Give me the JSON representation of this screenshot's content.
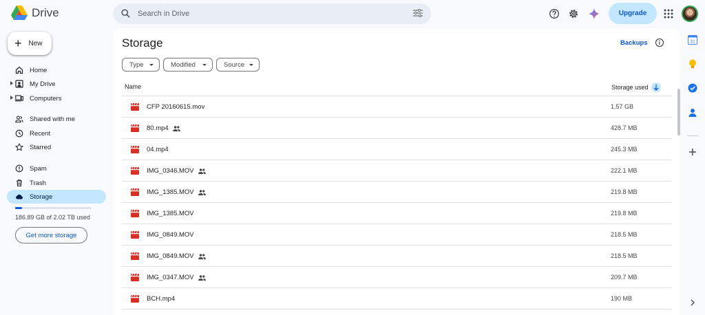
{
  "app": {
    "title": "Drive"
  },
  "search": {
    "placeholder": "Search in Drive"
  },
  "header": {
    "upgrade_label": "Upgrade"
  },
  "sidebar": {
    "new_label": "New",
    "items": [
      {
        "label": "Home",
        "icon": "home-icon"
      },
      {
        "label": "My Drive",
        "icon": "my-drive-icon"
      },
      {
        "label": "Computers",
        "icon": "computers-icon"
      },
      {
        "label": "Shared with me",
        "icon": "shared-with-me-icon"
      },
      {
        "label": "Recent",
        "icon": "clock-icon"
      },
      {
        "label": "Starred",
        "icon": "star-icon"
      },
      {
        "label": "Spam",
        "icon": "spam-icon"
      },
      {
        "label": "Trash",
        "icon": "trash-icon"
      },
      {
        "label": "Storage",
        "icon": "cloud-icon"
      }
    ],
    "storage_text": "186.89 GB of 2.02 TB used",
    "storage_fraction": 0.09,
    "get_more_label": "Get more storage"
  },
  "main": {
    "title": "Storage",
    "backups_label": "Backups",
    "filters": [
      "Type",
      "Modified",
      "Source"
    ],
    "columns": {
      "name": "Name",
      "size": "Storage used"
    },
    "files": [
      {
        "name": "CFP 20160615.mov",
        "size": "1.57 GB",
        "shared": false
      },
      {
        "name": "80.mp4",
        "size": "428.7 MB",
        "shared": true
      },
      {
        "name": "04.mp4",
        "size": "245.3 MB",
        "shared": false
      },
      {
        "name": "IMG_0346.MOV",
        "size": "222.1 MB",
        "shared": true
      },
      {
        "name": "IMG_1385.MOV",
        "size": "219.8 MB",
        "shared": true
      },
      {
        "name": "IMG_1385.MOV",
        "size": "219.8 MB",
        "shared": false
      },
      {
        "name": "IMG_0849.MOV",
        "size": "218.5 MB",
        "shared": false
      },
      {
        "name": "IMG_0849.MOV",
        "size": "218.5 MB",
        "shared": true
      },
      {
        "name": "IMG_0347.MOV",
        "size": "209.7 MB",
        "shared": true
      },
      {
        "name": "BCH.mp4",
        "size": "190 MB",
        "shared": false
      }
    ]
  },
  "right_rail": {
    "calendar_day": "31"
  },
  "colors": {
    "accent": "#0b57d0",
    "active_nav": "#c2e7ff",
    "video_icon": "#d93025",
    "background": "#f8fafd"
  }
}
